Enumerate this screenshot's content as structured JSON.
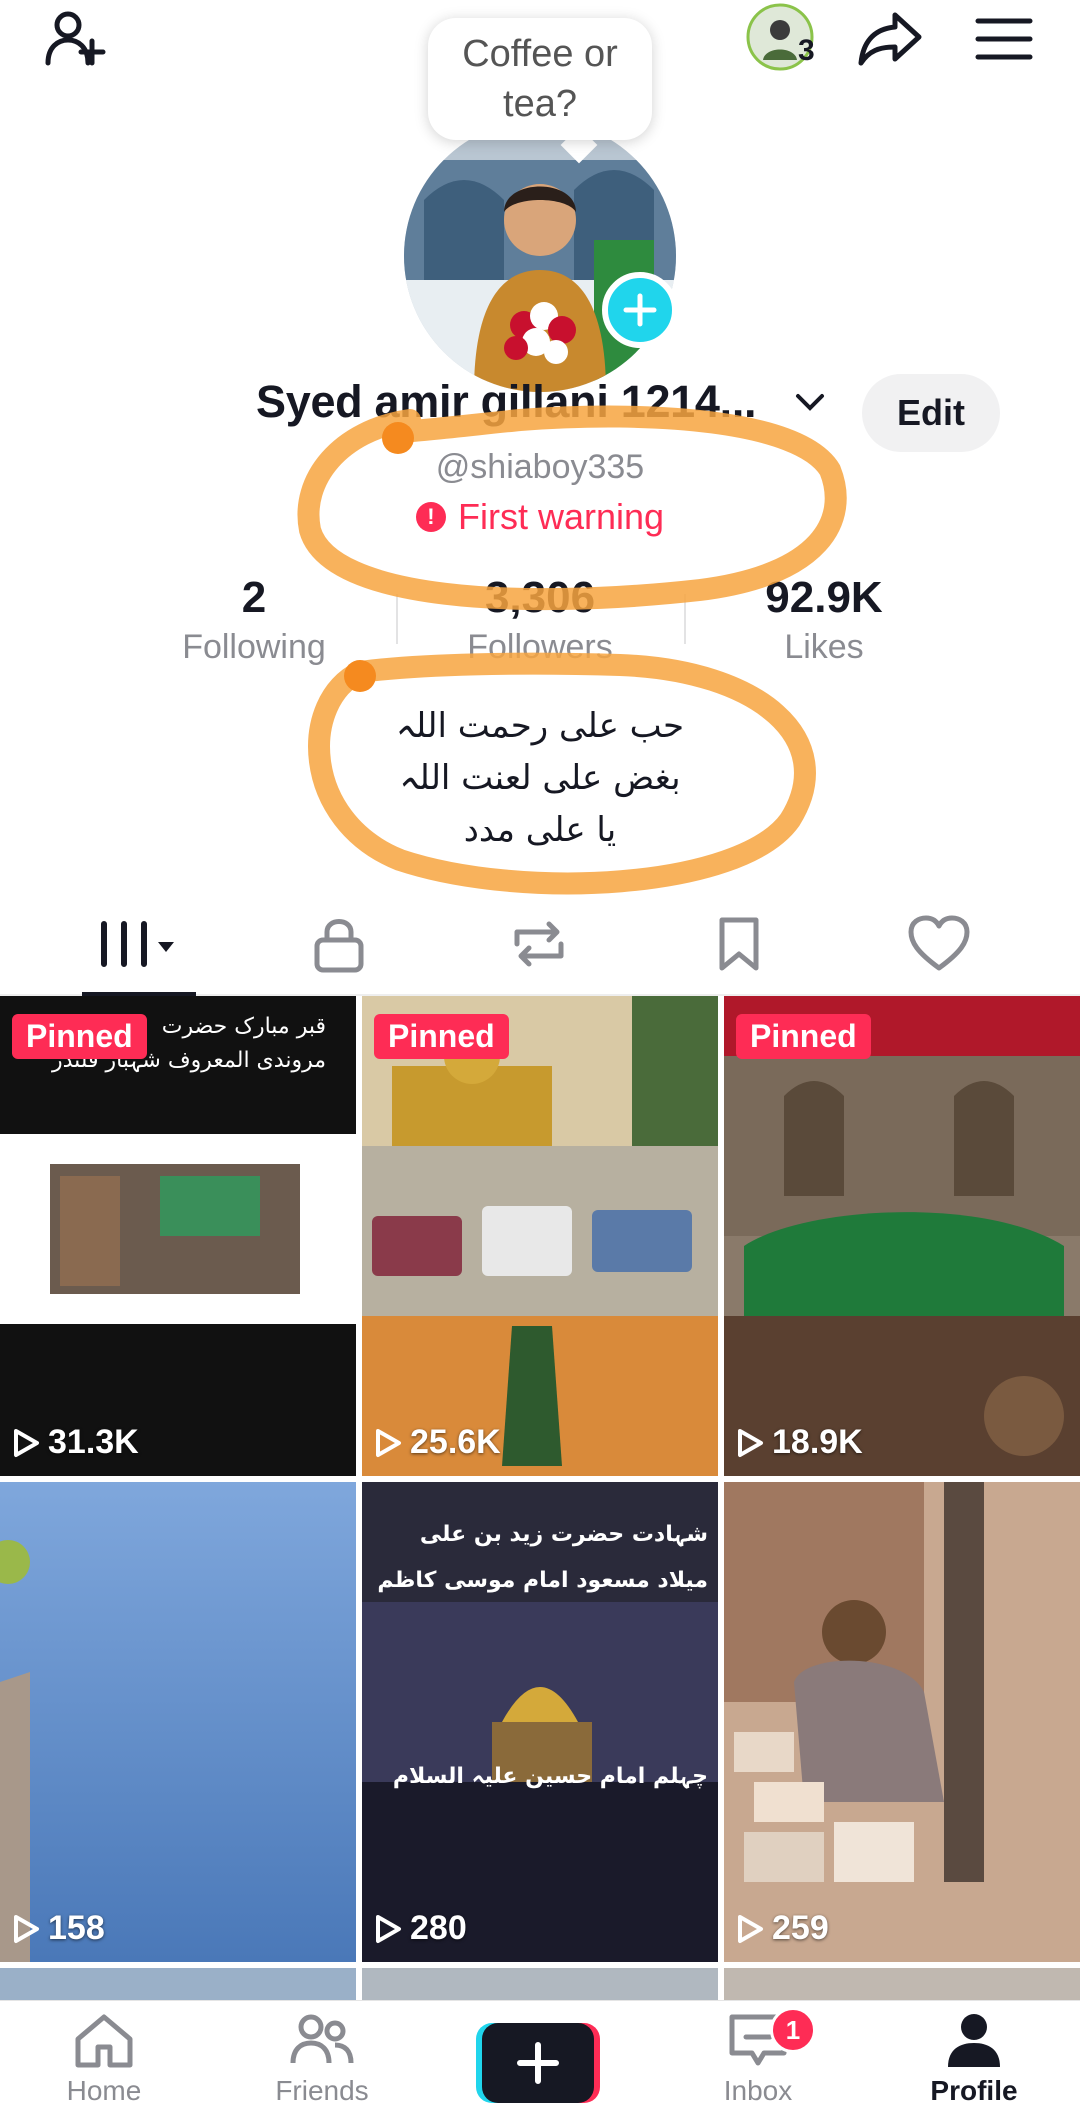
{
  "header": {
    "add_friend_icon": "person-plus-icon",
    "story_badge_count": "3",
    "share_icon": "share-arrow-icon",
    "menu_icon": "hamburger-menu-icon"
  },
  "note_bubble": {
    "text": "Coffee or tea?"
  },
  "profile": {
    "display_name": "Syed amir gillani 1214...",
    "edit_label": "Edit",
    "handle": "@shiaboy335",
    "warning_text": "First warning"
  },
  "stats": [
    {
      "value": "2",
      "label": "Following"
    },
    {
      "value": "3,306",
      "label": "Followers"
    },
    {
      "value": "92.9K",
      "label": "Likes"
    }
  ],
  "bio": {
    "line1": "حب علی رحمت اللہ",
    "line2": "بغض علی لعنت اللہ",
    "line3": "یا علی مدد"
  },
  "tabs": [
    "videos",
    "private",
    "reposts",
    "favorites",
    "liked"
  ],
  "videos": [
    {
      "pinned_label": "Pinned",
      "views": "31.3K",
      "caption_line1": "قبر مبارک حضرت",
      "caption_line2": "مروندی المعروف شہباز قلندر"
    },
    {
      "pinned_label": "Pinned",
      "views": "25.6K"
    },
    {
      "pinned_label": "Pinned",
      "views": "18.9K"
    },
    {
      "views": "158"
    },
    {
      "views": "280",
      "caption_line1": "شہادت حضرت زید بن علی",
      "caption_line2": "میلاد مسعود امام موسی کاظم",
      "caption_line3": "چہلم امام حسین علیہ السلام"
    },
    {
      "views": "259"
    }
  ],
  "bottom_nav": {
    "home": "Home",
    "friends": "Friends",
    "inbox": "Inbox",
    "inbox_badge": "1",
    "profile": "Profile"
  },
  "colors": {
    "accent": "#fe2c55",
    "cyan": "#20d5ec",
    "annotation": "#f7a440"
  }
}
